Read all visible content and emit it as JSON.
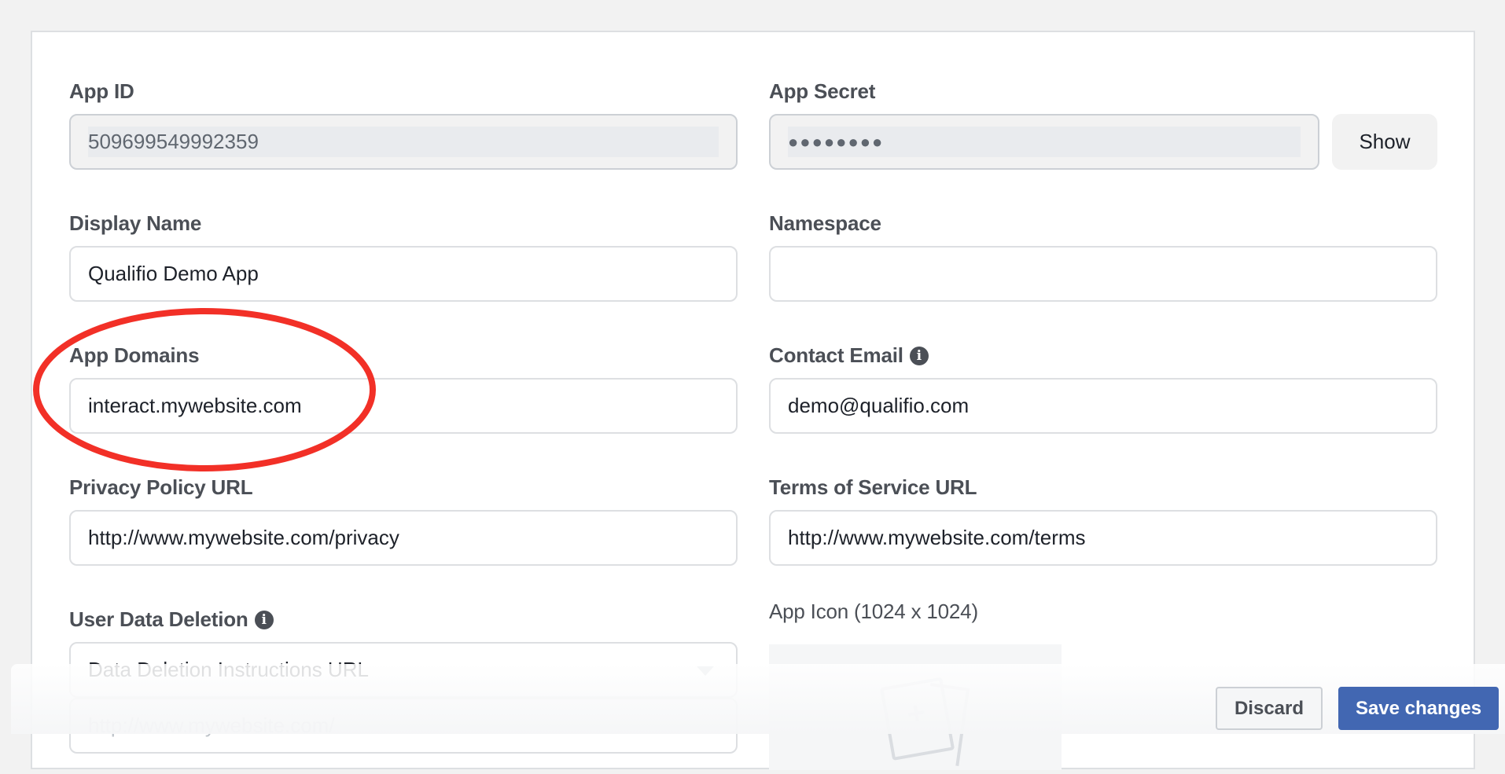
{
  "fields": {
    "app_id": {
      "label": "App ID",
      "value": "509699549992359"
    },
    "app_secret": {
      "label": "App Secret",
      "value": "●●●●●●●●",
      "show_label": "Show"
    },
    "display_name": {
      "label": "Display Name",
      "value": "Qualifio Demo App"
    },
    "namespace": {
      "label": "Namespace",
      "value": ""
    },
    "app_domains": {
      "label": "App Domains",
      "value": "interact.mywebsite.com"
    },
    "contact_email": {
      "label": "Contact Email",
      "value": "demo@qualifio.com",
      "info_icon": "i"
    },
    "privacy_policy_url": {
      "label": "Privacy Policy URL",
      "value": "http://www.mywebsite.com/privacy"
    },
    "terms_of_service_url": {
      "label": "Terms of Service URL",
      "value": "http://www.mywebsite.com/terms"
    },
    "user_data_deletion": {
      "label": "User Data Deletion",
      "info_icon": "i",
      "selected": "Data Deletion Instructions URL",
      "url_placeholder": "http://www.mywebsite.com/"
    },
    "app_icon": {
      "label": "App Icon (1024 x 1024)"
    }
  },
  "actions": {
    "discard_label": "Discard",
    "save_label": "Save changes"
  },
  "colors": {
    "primary": "#4267b2",
    "annotation": "#f23027"
  }
}
